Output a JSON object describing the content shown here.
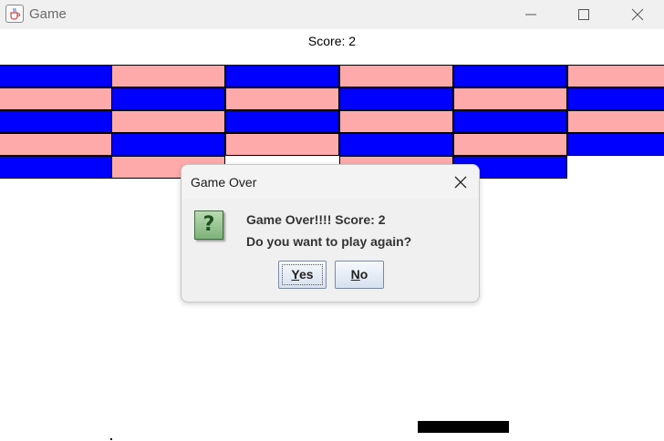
{
  "window": {
    "title": "Game",
    "app_icon": "java-cup-icon",
    "controls": [
      "minimize-icon",
      "maximize-icon",
      "close-icon"
    ]
  },
  "game": {
    "score_text": "Score: 2",
    "colors": {
      "blue": "#0000ff",
      "pink": "#ffaaaa",
      "paddle": "#000000"
    }
  },
  "dialog": {
    "title": "Game Over",
    "icon": "question-icon",
    "icon_glyph": "?",
    "message_line1": "Game Over!!!! Score: 2",
    "message_line2": "Do you want to play again?",
    "yes_mnemonic": "Y",
    "yes_rest": "es",
    "no_mnemonic": "N",
    "no_rest": "o"
  }
}
